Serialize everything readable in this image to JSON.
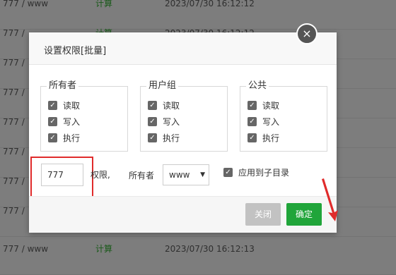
{
  "background_rows": [
    {
      "perm": "777 / www",
      "owner": "计算",
      "time": "2023/07/30 16:12:12"
    },
    {
      "perm": "777 /",
      "owner": "计算",
      "time": "2023/07/30 16:12:12"
    },
    {
      "perm": "777 /",
      "owner": "",
      "time": ""
    },
    {
      "perm": "777 /",
      "owner": "",
      "time": ""
    },
    {
      "perm": "777 /",
      "owner": "",
      "time": ""
    },
    {
      "perm": "777 /",
      "owner": "",
      "time": ""
    },
    {
      "perm": "777 /",
      "owner": "",
      "time": ""
    },
    {
      "perm": "777 /",
      "owner": "",
      "time": ""
    },
    {
      "perm": "777 / www",
      "owner": "计算",
      "time": "2023/07/30 16:12:13"
    }
  ],
  "dialog": {
    "title": "设置权限[批量]",
    "close_icon": "×",
    "groups": [
      {
        "legend": "所有者",
        "items": [
          "读取",
          "写入",
          "执行"
        ]
      },
      {
        "legend": "用户组",
        "items": [
          "读取",
          "写入",
          "执行"
        ]
      },
      {
        "legend": "公共",
        "items": [
          "读取",
          "写入",
          "执行"
        ]
      }
    ],
    "permission_value": "777",
    "permission_label": "权限,",
    "owner_label": "所有者",
    "owner_value": "www",
    "recursive_label": "应用到子目录",
    "buttons": {
      "close": "关闭",
      "ok": "确定"
    }
  },
  "colors": {
    "ok": "#20a53a",
    "highlight": "#e02b2b"
  }
}
